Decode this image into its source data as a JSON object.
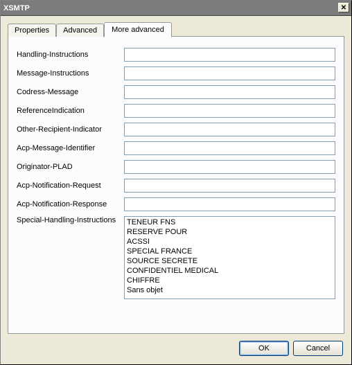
{
  "window": {
    "title": "XSMTP"
  },
  "tabs": {
    "properties": "Properties",
    "advanced": "Advanced",
    "more_advanced": "More advanced"
  },
  "form": {
    "handling_instructions": {
      "label": "Handling-Instructions",
      "value": ""
    },
    "message_instructions": {
      "label": "Message-Instructions",
      "value": ""
    },
    "codress_message": {
      "label": "Codress-Message",
      "value": ""
    },
    "reference_indication": {
      "label": "ReferenceIndication",
      "value": ""
    },
    "other_recipient_indicator": {
      "label": "Other-Recipient-Indicator",
      "value": ""
    },
    "acp_message_identifier": {
      "label": "Acp-Message-Identifier",
      "value": ""
    },
    "originator_plad": {
      "label": "Originator-PLAD",
      "value": ""
    },
    "acp_notification_request": {
      "label": "Acp-Notification-Request",
      "value": ""
    },
    "acp_notification_response": {
      "label": "Acp-Notification-Response",
      "value": ""
    },
    "special_handling_instructions": {
      "label": "Special-Handling-Instructions",
      "items": [
        "TENEUR FNS",
        "RESERVE POUR",
        "ACSSI",
        "SPECIAL FRANCE",
        "SOURCE SECRETE",
        "CONFIDENTIEL MEDICAL",
        "CHIFFRE",
        "Sans objet"
      ]
    }
  },
  "buttons": {
    "ok": "OK",
    "cancel": "Cancel"
  }
}
